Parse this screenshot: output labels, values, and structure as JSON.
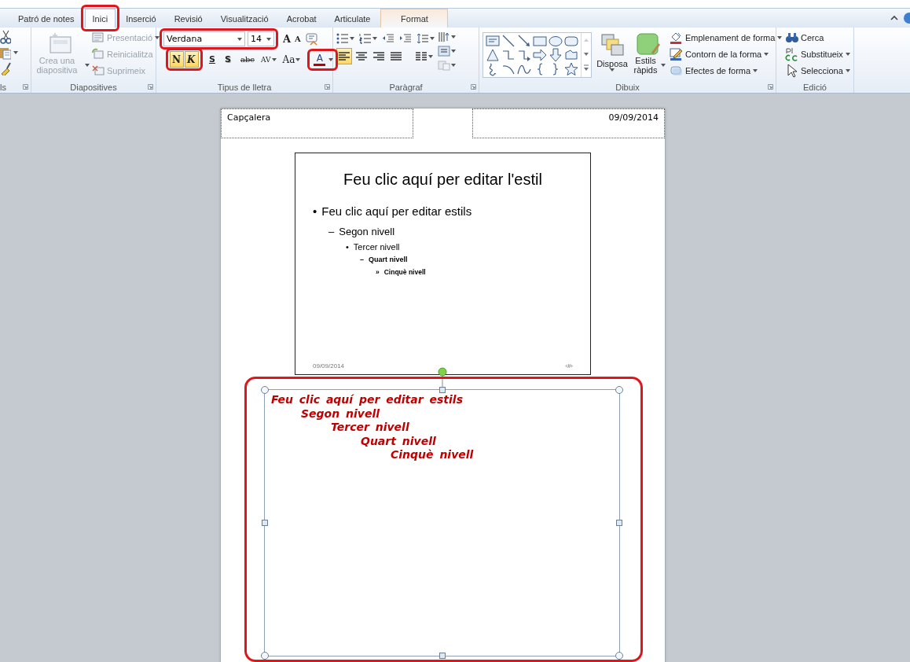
{
  "tabs": [
    {
      "label": "Patró de notes",
      "kind": "normal",
      "selected": false,
      "highlighted": false
    },
    {
      "label": "Inici",
      "kind": "normal",
      "selected": true,
      "highlighted": true
    },
    {
      "label": "Inserció",
      "kind": "normal",
      "selected": false,
      "highlighted": false
    },
    {
      "label": "Revisió",
      "kind": "normal",
      "selected": false,
      "highlighted": false
    },
    {
      "label": "Visualització",
      "kind": "normal",
      "selected": false,
      "highlighted": false
    },
    {
      "label": "Acrobat",
      "kind": "normal",
      "selected": false,
      "highlighted": false
    },
    {
      "label": "Articulate",
      "kind": "normal",
      "selected": false,
      "highlighted": false
    },
    {
      "label": "Format",
      "kind": "contextual",
      "selected": false,
      "highlighted": false
    }
  ],
  "ribbon": {
    "groups": [
      {
        "kind": "clipboard",
        "label": "ls"
      },
      {
        "kind": "slides",
        "label": "Diapositives",
        "new_slide": {
          "label": "Crea una diapositiva",
          "disabled": true
        },
        "commands": [
          {
            "kind": "layout",
            "label": "Presentació",
            "disabled": true
          },
          {
            "kind": "reset",
            "label": "Reinicialitza",
            "disabled": true
          },
          {
            "kind": "delete",
            "label": "Suprimeix",
            "disabled": true
          }
        ]
      },
      {
        "kind": "font",
        "label": "Tipus de lletra",
        "font_fields": {
          "highlighted": true,
          "font": "Verdana",
          "size": "14"
        },
        "size_buttons": [
          {
            "kind": "grow",
            "glyph": "A"
          },
          {
            "kind": "shrink",
            "glyph": "A"
          }
        ],
        "style_toggles": {
          "highlighted": true,
          "buttons": [
            {
              "kind": "bold",
              "glyph": "N",
              "selected": true
            },
            {
              "kind": "italic",
              "glyph": "K",
              "selected": true
            }
          ]
        },
        "format_buttons": [
          {
            "kind": "underline",
            "glyph": "S",
            "selected": false
          },
          {
            "kind": "shadow",
            "glyph": "S",
            "selected": false
          },
          {
            "kind": "strike",
            "glyph": "abc",
            "selected": false
          },
          {
            "kind": "spacing",
            "glyph": "AV",
            "selected": false
          },
          {
            "kind": "case",
            "glyph": "Aa",
            "selected": false
          }
        ],
        "font_color": {
          "glyph": "A",
          "color": "#c00000",
          "highlighted": true
        }
      },
      {
        "kind": "paragraph",
        "label": "Paràgraf",
        "alignment": [
          {
            "kind": "left",
            "selected": true
          },
          {
            "kind": "center",
            "selected": false
          },
          {
            "kind": "right",
            "selected": false
          },
          {
            "kind": "justify",
            "selected": false
          }
        ]
      },
      {
        "kind": "drawing",
        "label": "Dibuix",
        "arrange": "Disposa",
        "quick_styles": "Estils ràpids",
        "shape_commands": [
          {
            "kind": "fill",
            "label": "Emplenament de forma"
          },
          {
            "kind": "outline",
            "label": "Contorn de la forma"
          },
          {
            "kind": "effects",
            "label": "Efectes de forma"
          }
        ]
      },
      {
        "kind": "editing",
        "label": "Edició",
        "commands": [
          {
            "kind": "find",
            "label": "Cerca"
          },
          {
            "kind": "replace",
            "label": "Substitueix"
          },
          {
            "kind": "select",
            "label": "Selecciona"
          }
        ]
      }
    ]
  },
  "notes_page": {
    "header": "Capçalera",
    "date": "09/09/2014",
    "slide": {
      "title": "Feu clic aquí per editar l'estil",
      "bullets": [
        {
          "bullet": "•",
          "text": "Feu clic aquí per editar estils",
          "children": [
            {
              "bullet": "–",
              "text": "Segon nivell",
              "children": [
                {
                  "bullet": "•",
                  "text": "Tercer nivell",
                  "children": [
                    {
                      "bullet": "–",
                      "text": "Quart nivell",
                      "children": [
                        {
                          "bullet": "»",
                          "text": "Cinquè nivell"
                        }
                      ]
                    }
                  ]
                }
              ]
            }
          ]
        }
      ],
      "footer_date": "09/09/2014",
      "footer_number": "‹#›"
    },
    "notes": {
      "highlighted": true,
      "levels": [
        {
          "text": "Feu clic aquí per editar estils",
          "children": [
            {
              "text": "Segon nivell",
              "children": [
                {
                  "text": "Tercer nivell",
                  "children": [
                    {
                      "text": "Quart nivell",
                      "children": [
                        {
                          "text": "Cinquè nivell"
                        }
                      ]
                    }
                  ]
                }
              ]
            }
          ]
        }
      ]
    }
  }
}
